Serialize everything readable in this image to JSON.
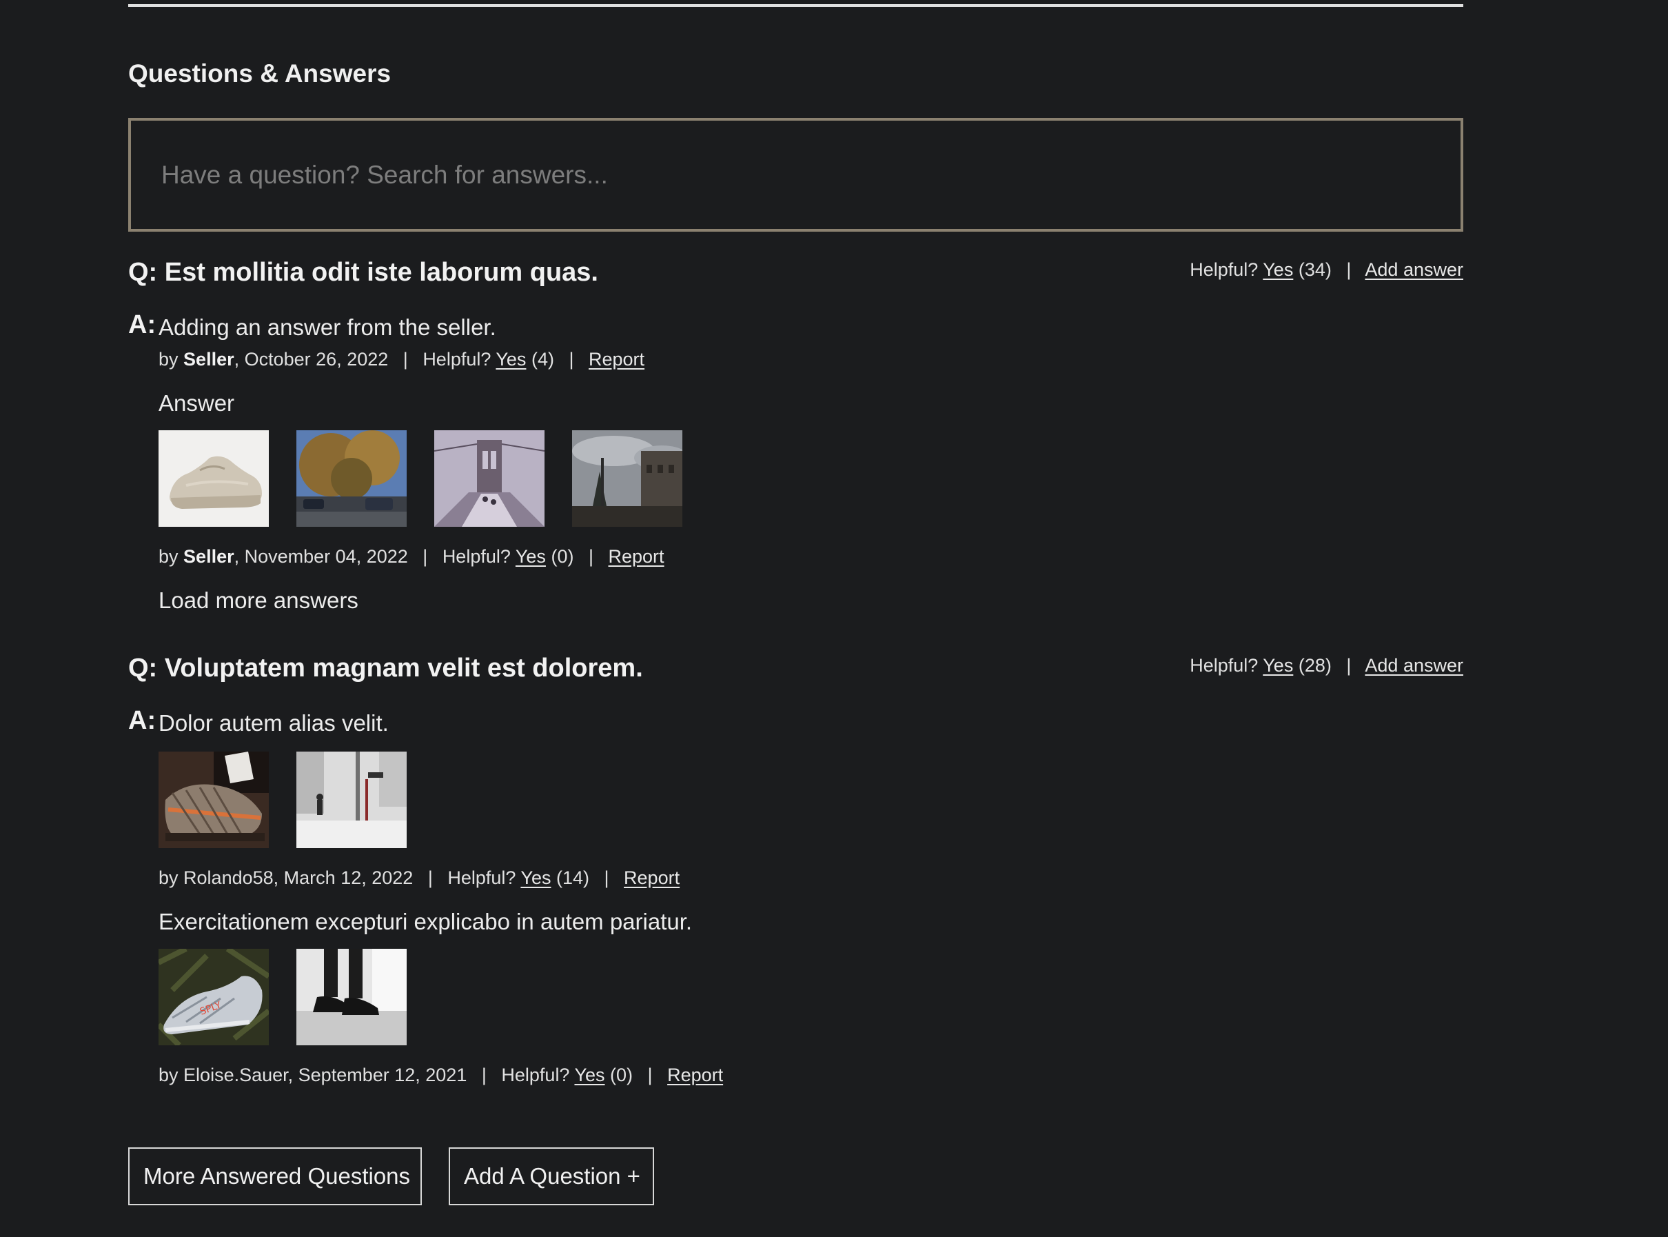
{
  "section": {
    "title": "Questions & Answers",
    "search_placeholder": "Have a question? Search for answers..."
  },
  "questions": [
    {
      "text": "Q: Est mollitia odit iste laborum quas.",
      "helpful_label": "Helpful?",
      "yes_label": "Yes",
      "helpful_count": "(34)",
      "separator": "|",
      "add_answer_label": "Add answer",
      "answers": [
        {
          "label": "A:",
          "body": "Adding an answer from the seller.",
          "by_prefix": "by",
          "author": "Seller",
          "date": ", October 26, 2022",
          "helpful_label": "Helpful?",
          "yes_label": "Yes",
          "helpful_count": "(4)",
          "report_label": "Report",
          "photos": []
        },
        {
          "label": "",
          "body": "Answer",
          "by_prefix": "by",
          "author": "Seller",
          "date": ", November 04, 2022",
          "helpful_label": "Helpful?",
          "yes_label": "Yes",
          "helpful_count": "(0)",
          "report_label": "Report",
          "photos": [
            "sneaker-beige-photo",
            "autumn-street-photo",
            "bridge-walkway-photo",
            "cloudy-castle-photo"
          ]
        }
      ],
      "load_more_label": "Load more answers"
    },
    {
      "text": "Q: Voluptatem magnam velit est dolorem.",
      "helpful_label": "Helpful?",
      "yes_label": "Yes",
      "helpful_count": "(28)",
      "separator": "|",
      "add_answer_label": "Add answer",
      "answers": [
        {
          "label": "A:",
          "body": "Dolor autem alias velit.",
          "by_prefix": "by",
          "author": "Rolando58",
          "date": ", March 12, 2022",
          "helpful_label": "Helpful?",
          "yes_label": "Yes",
          "helpful_count": "(14)",
          "report_label": "Report",
          "photos": [
            "striped-sneaker-photo",
            "snowy-street-photo"
          ]
        },
        {
          "label": "",
          "body": "Exercitationem excepturi explicabo in autem pariatur.",
          "by_prefix": "by",
          "author": "Eloise.Sauer",
          "date": ", September 12, 2021",
          "helpful_label": "Helpful?",
          "yes_label": "Yes",
          "helpful_count": "(0)",
          "report_label": "Report",
          "photos": [
            "white-sneaker-leaves-photo",
            "black-sneakers-floor-photo"
          ]
        }
      ]
    }
  ],
  "buttons": {
    "more_questions": "More Answered Questions",
    "add_question": "Add A Question +"
  },
  "colors": {
    "background": "#1b1c1e",
    "search_border": "#8b8170",
    "text": "#e8e8e8"
  }
}
